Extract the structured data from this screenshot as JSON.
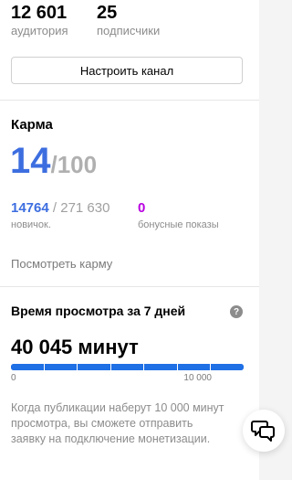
{
  "stats": [
    {
      "value": "12 601",
      "label": "аудитория"
    },
    {
      "value": "25",
      "label": "подписчики"
    }
  ],
  "settings_button": "Настроить канал",
  "karma": {
    "title": "Карма",
    "value": "14",
    "max": "/100",
    "current": "14764",
    "total": "271 630",
    "level_label": "новичок.",
    "bonus_value": "0",
    "bonus_label": "бонусные показы",
    "link": "Посмотреть карму"
  },
  "watch_time": {
    "title": "Время просмотра за 7 дней",
    "value": "40 045 минут",
    "scale_min": "0",
    "scale_max": "10 000",
    "progress_fraction": 1.0,
    "note": "Когда публикации наберут 10 000 минут просмотра, вы сможете отправить заявку на подключение монетизации."
  },
  "icons": {
    "help": "question-circle-icon",
    "chat": "chat-bubbles-icon"
  },
  "colors": {
    "accent": "#3d6ee0",
    "bonus": "#b800e0",
    "progress": "#2d7ae8"
  }
}
